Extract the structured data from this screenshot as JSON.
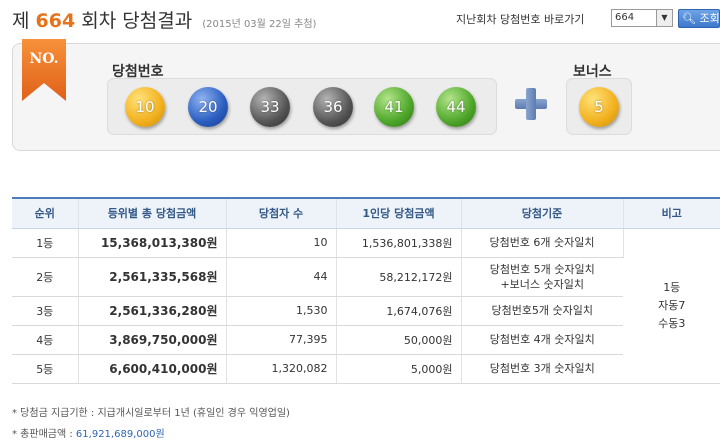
{
  "header": {
    "title_prefix": "제",
    "round_number": "664",
    "title_suffix": "회차 당첨결과",
    "draw_date": "(2015년 03월 22일 추첨)",
    "jump_label": "지난회차 당첨번호 바로가기",
    "jump_selected": "664",
    "search_label": "조회"
  },
  "result": {
    "badge": "NO.",
    "winning_label": "당첨번호",
    "bonus_label": "보너스",
    "numbers": [
      "10",
      "20",
      "33",
      "36",
      "41",
      "44"
    ],
    "bonus": "5",
    "colors": {
      "yellow": "#f2b01d",
      "blue": "#2a5dc0",
      "gray": "#555555",
      "green": "#4ea62a",
      "accent": "#e5731c"
    }
  },
  "table": {
    "headers": [
      "순위",
      "등위별 총 당첨금액",
      "당첨자 수",
      "1인당 당첨금액",
      "당첨기준",
      "비고"
    ],
    "rows": [
      {
        "rank": "1등",
        "total": "15,368,013,380원",
        "winners": "10",
        "per": "1,536,801,338원",
        "criteria": "당첨번호 6개 숫자일치"
      },
      {
        "rank": "2등",
        "total": "2,561,335,568원",
        "winners": "44",
        "per": "58,212,172원",
        "criteria": "당첨번호 5개 숫자일치",
        "criteria2": "+보너스 숫자일치"
      },
      {
        "rank": "3등",
        "total": "2,561,336,280원",
        "winners": "1,530",
        "per": "1,674,076원",
        "criteria": "당첨번호5개 숫자일치"
      },
      {
        "rank": "4등",
        "total": "3,869,750,000원",
        "winners": "77,395",
        "per": "50,000원",
        "criteria": "당첨번호 4개 숫자일치"
      },
      {
        "rank": "5등",
        "total": "6,600,410,000원",
        "winners": "1,320,082",
        "per": "5,000원",
        "criteria": "당첨번호 3개 숫자일치"
      }
    ],
    "note_lines": [
      "1등",
      "자동7",
      "수동3"
    ]
  },
  "footer": {
    "deadline": "* 당첨금 지급기한 : 지급개시일로부터 1년 (휴일인 경우 익영업일)",
    "sales_label": "* 총판매금액 :",
    "sales_value": "61,921,689,000원"
  }
}
